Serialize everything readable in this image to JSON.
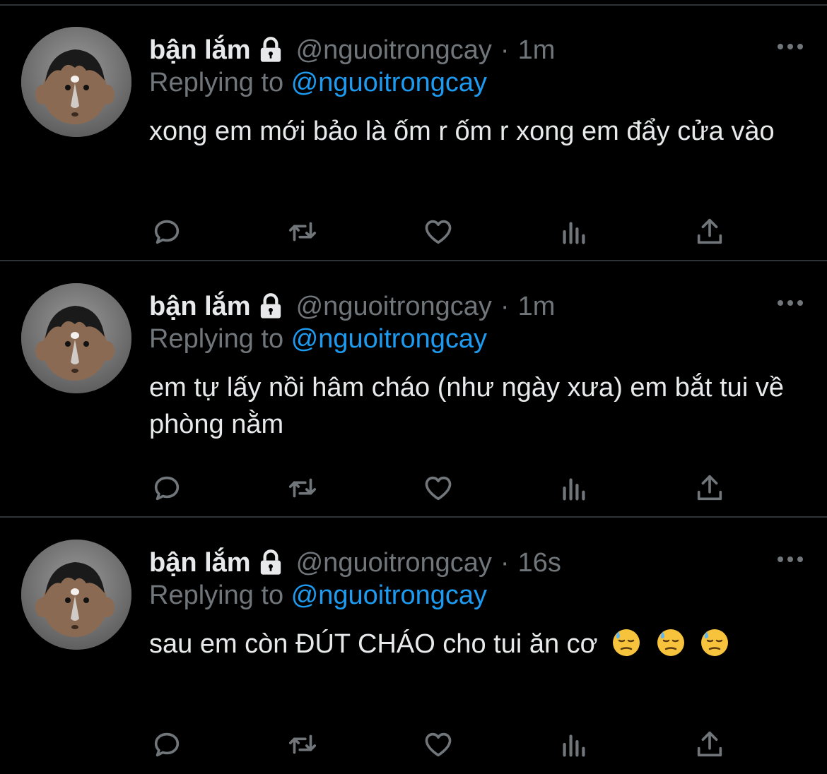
{
  "colors": {
    "background": "#000000",
    "text": "#e7e9ea",
    "muted": "#71767b",
    "link": "#1d9bf0",
    "divider": "#2f3336"
  },
  "tweets": [
    {
      "display_name": "bận lắm",
      "handle": "@nguoitrongcay",
      "separator": "·",
      "time": "1m",
      "replying_prefix": "Replying to",
      "replying_to": "@nguoitrongcay",
      "text": "xong em mới bảo là ốm r ốm r xong em đẩy cửa vào",
      "icons": {
        "lock": "lock-icon",
        "more": "more-horizontal-icon",
        "reply": "reply-icon",
        "retweet": "retweet-icon",
        "like": "heart-icon",
        "views": "analytics-icon",
        "share": "share-icon"
      }
    },
    {
      "display_name": "bận lắm",
      "handle": "@nguoitrongcay",
      "separator": "·",
      "time": "1m",
      "replying_prefix": "Replying to",
      "replying_to": "@nguoitrongcay",
      "text": "em tự lấy nồi hâm cháo (như ngày xưa) em bắt tui về phòng nằm",
      "icons": {
        "lock": "lock-icon",
        "more": "more-horizontal-icon",
        "reply": "reply-icon",
        "retweet": "retweet-icon",
        "like": "heart-icon",
        "views": "analytics-icon",
        "share": "share-icon"
      }
    },
    {
      "display_name": "bận lắm",
      "handle": "@nguoitrongcay",
      "separator": "·",
      "time": "16s",
      "replying_prefix": "Replying to",
      "replying_to": "@nguoitrongcay",
      "text": "sau em còn ĐÚT CHÁO cho tui ăn cơ",
      "emojis": [
        "downcast-face-with-sweat",
        "downcast-face-with-sweat",
        "downcast-face-with-sweat"
      ],
      "icons": {
        "lock": "lock-icon",
        "more": "more-horizontal-icon",
        "reply": "reply-icon",
        "retweet": "retweet-icon",
        "like": "heart-icon",
        "views": "analytics-icon",
        "share": "share-icon"
      }
    }
  ]
}
